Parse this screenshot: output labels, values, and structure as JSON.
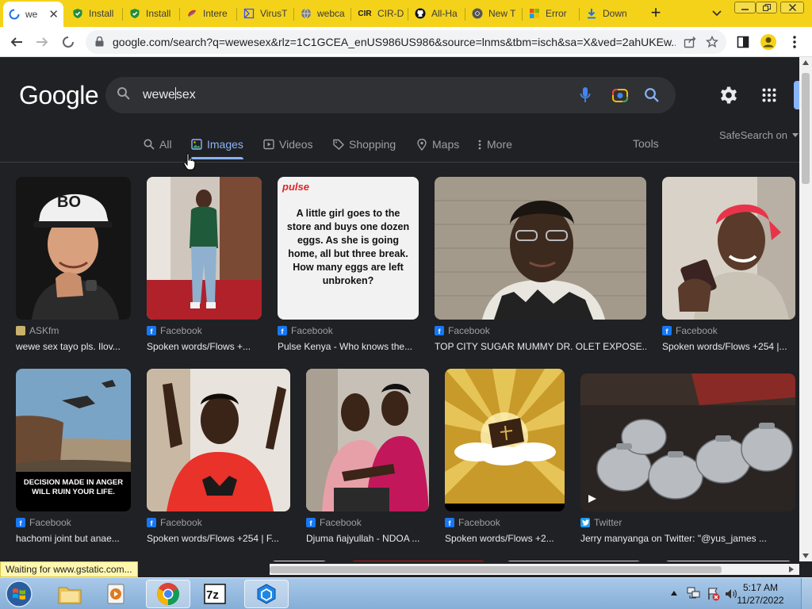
{
  "browser": {
    "tabs": [
      {
        "title": "we",
        "active": true,
        "icon": "loading-spinner-icon"
      },
      {
        "title": "Install",
        "icon": "shield-check-icon"
      },
      {
        "title": "Install",
        "icon": "shield-check-icon"
      },
      {
        "title": "Intere",
        "icon": "interest-icon"
      },
      {
        "title": "VirusT",
        "icon": "virustotal-icon"
      },
      {
        "title": "webca",
        "icon": "globe-icon"
      },
      {
        "title": "CIR-D",
        "icon": "cir-logo-icon",
        "favicon_text": "CIR"
      },
      {
        "title": "All-Ha",
        "icon": "github-icon"
      },
      {
        "title": "New T",
        "icon": "chrome-icon"
      },
      {
        "title": "Error",
        "icon": "windows-logo-icon"
      },
      {
        "title": "Down",
        "icon": "download-icon"
      }
    ],
    "url": "google.com/search?q=wewesex&rlz=1C1GCEA_enUS986US986&source=lnms&tbm=isch&sa=X&ved=2ahUKEw...",
    "status": "Waiting for www.gstatic.com..."
  },
  "google": {
    "logo": "Google",
    "query_before_caret": "wewe",
    "query_after_caret": "sex",
    "tabs": [
      {
        "label": "All",
        "icon": "search-icon"
      },
      {
        "label": "Images",
        "icon": "image-icon",
        "active": true
      },
      {
        "label": "Videos",
        "icon": "video-icon"
      },
      {
        "label": "Shopping",
        "icon": "tag-icon"
      },
      {
        "label": "Maps",
        "icon": "map-pin-icon"
      },
      {
        "label": "More",
        "icon": "more-vert-icon"
      }
    ],
    "tools_label": "Tools",
    "safesearch_label": "SafeSearch on"
  },
  "results": [
    {
      "source": "ASKfm",
      "title": "wewe sex tayo pls. Ilov...",
      "source_icon": "askfm-icon"
    },
    {
      "source": "Facebook",
      "title": "Spoken words/Flows +...",
      "source_icon": "facebook-icon"
    },
    {
      "source": "Facebook",
      "title": "Pulse Kenya - Who knows the...",
      "source_icon": "facebook-icon",
      "image_brand": "pulse",
      "image_text": "A little girl goes to the store and buys one dozen eggs. As she is going home, all but three break. How many eggs are left unbroken?"
    },
    {
      "source": "Facebook",
      "title": "TOP CITY SUGAR MUMMY DR. OLET EXPOSE...",
      "source_icon": "facebook-icon"
    },
    {
      "source": "Facebook",
      "title": "Spoken words/Flows +254 |...",
      "source_icon": "facebook-icon"
    },
    {
      "source": "Facebook",
      "title": "hachomi joint but anae...",
      "source_icon": "facebook-icon",
      "image_text": "DECISION MADE IN ANGER WILL RUIN YOUR LIFE."
    },
    {
      "source": "Facebook",
      "title": "Spoken words/Flows +254 | F...",
      "source_icon": "facebook-icon"
    },
    {
      "source": "Facebook",
      "title": "Djuma ñajyullah - NDOA ...",
      "source_icon": "facebook-icon"
    },
    {
      "source": "Facebook",
      "title": "Spoken words/Flows +2...",
      "source_icon": "facebook-icon"
    },
    {
      "source": "Twitter",
      "title": "Jerry manyanga on Twitter: \"@yus_james ...",
      "source_icon": "twitter-icon"
    }
  ],
  "taskbar": {
    "apps": [
      "file-explorer-icon",
      "media-player-icon",
      "chrome-icon",
      "7zip-icon",
      "hex-app-icon"
    ],
    "time": "5:17 AM",
    "date": "11/27/2022"
  }
}
